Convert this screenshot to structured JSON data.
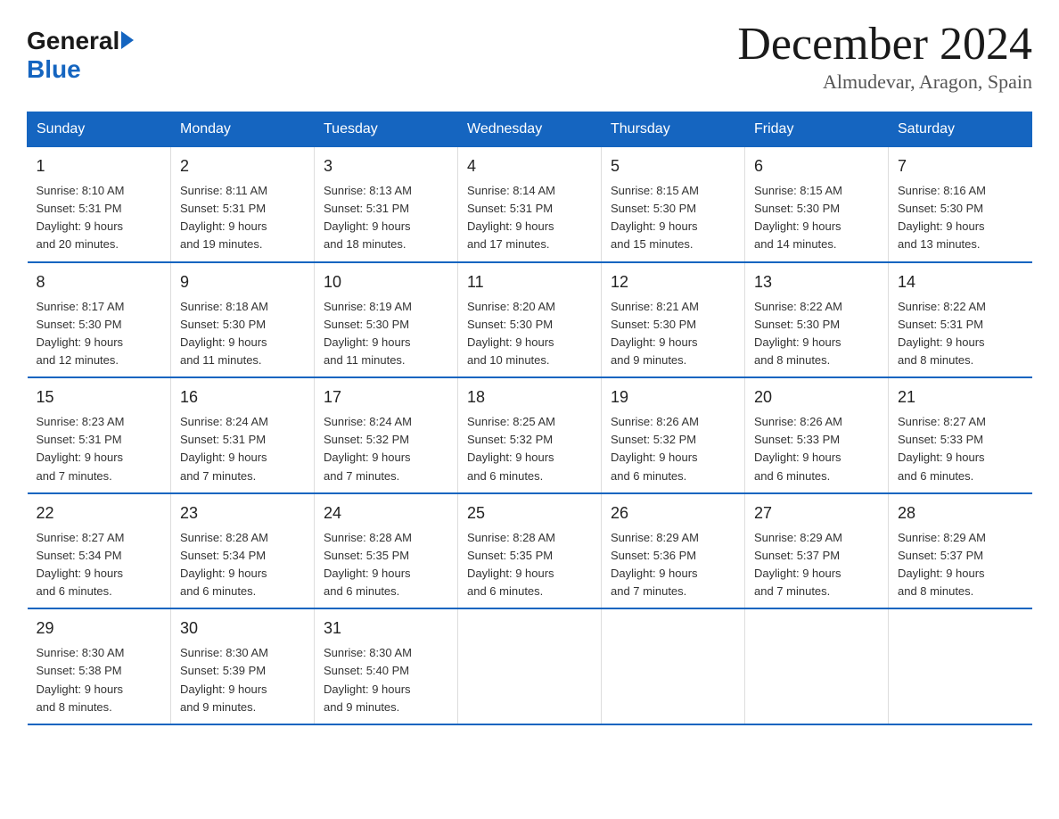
{
  "logo": {
    "general": "General",
    "blue": "Blue"
  },
  "title": {
    "month_year": "December 2024",
    "location": "Almudevar, Aragon, Spain"
  },
  "days_of_week": [
    "Sunday",
    "Monday",
    "Tuesday",
    "Wednesday",
    "Thursday",
    "Friday",
    "Saturday"
  ],
  "weeks": [
    [
      {
        "day": "1",
        "sunrise": "8:10 AM",
        "sunset": "5:31 PM",
        "daylight": "9 hours and 20 minutes."
      },
      {
        "day": "2",
        "sunrise": "8:11 AM",
        "sunset": "5:31 PM",
        "daylight": "9 hours and 19 minutes."
      },
      {
        "day": "3",
        "sunrise": "8:13 AM",
        "sunset": "5:31 PM",
        "daylight": "9 hours and 18 minutes."
      },
      {
        "day": "4",
        "sunrise": "8:14 AM",
        "sunset": "5:31 PM",
        "daylight": "9 hours and 17 minutes."
      },
      {
        "day": "5",
        "sunrise": "8:15 AM",
        "sunset": "5:30 PM",
        "daylight": "9 hours and 15 minutes."
      },
      {
        "day": "6",
        "sunrise": "8:15 AM",
        "sunset": "5:30 PM",
        "daylight": "9 hours and 14 minutes."
      },
      {
        "day": "7",
        "sunrise": "8:16 AM",
        "sunset": "5:30 PM",
        "daylight": "9 hours and 13 minutes."
      }
    ],
    [
      {
        "day": "8",
        "sunrise": "8:17 AM",
        "sunset": "5:30 PM",
        "daylight": "9 hours and 12 minutes."
      },
      {
        "day": "9",
        "sunrise": "8:18 AM",
        "sunset": "5:30 PM",
        "daylight": "9 hours and 11 minutes."
      },
      {
        "day": "10",
        "sunrise": "8:19 AM",
        "sunset": "5:30 PM",
        "daylight": "9 hours and 11 minutes."
      },
      {
        "day": "11",
        "sunrise": "8:20 AM",
        "sunset": "5:30 PM",
        "daylight": "9 hours and 10 minutes."
      },
      {
        "day": "12",
        "sunrise": "8:21 AM",
        "sunset": "5:30 PM",
        "daylight": "9 hours and 9 minutes."
      },
      {
        "day": "13",
        "sunrise": "8:22 AM",
        "sunset": "5:30 PM",
        "daylight": "9 hours and 8 minutes."
      },
      {
        "day": "14",
        "sunrise": "8:22 AM",
        "sunset": "5:31 PM",
        "daylight": "9 hours and 8 minutes."
      }
    ],
    [
      {
        "day": "15",
        "sunrise": "8:23 AM",
        "sunset": "5:31 PM",
        "daylight": "9 hours and 7 minutes."
      },
      {
        "day": "16",
        "sunrise": "8:24 AM",
        "sunset": "5:31 PM",
        "daylight": "9 hours and 7 minutes."
      },
      {
        "day": "17",
        "sunrise": "8:24 AM",
        "sunset": "5:32 PM",
        "daylight": "9 hours and 7 minutes."
      },
      {
        "day": "18",
        "sunrise": "8:25 AM",
        "sunset": "5:32 PM",
        "daylight": "9 hours and 6 minutes."
      },
      {
        "day": "19",
        "sunrise": "8:26 AM",
        "sunset": "5:32 PM",
        "daylight": "9 hours and 6 minutes."
      },
      {
        "day": "20",
        "sunrise": "8:26 AM",
        "sunset": "5:33 PM",
        "daylight": "9 hours and 6 minutes."
      },
      {
        "day": "21",
        "sunrise": "8:27 AM",
        "sunset": "5:33 PM",
        "daylight": "9 hours and 6 minutes."
      }
    ],
    [
      {
        "day": "22",
        "sunrise": "8:27 AM",
        "sunset": "5:34 PM",
        "daylight": "9 hours and 6 minutes."
      },
      {
        "day": "23",
        "sunrise": "8:28 AM",
        "sunset": "5:34 PM",
        "daylight": "9 hours and 6 minutes."
      },
      {
        "day": "24",
        "sunrise": "8:28 AM",
        "sunset": "5:35 PM",
        "daylight": "9 hours and 6 minutes."
      },
      {
        "day": "25",
        "sunrise": "8:28 AM",
        "sunset": "5:35 PM",
        "daylight": "9 hours and 6 minutes."
      },
      {
        "day": "26",
        "sunrise": "8:29 AM",
        "sunset": "5:36 PM",
        "daylight": "9 hours and 7 minutes."
      },
      {
        "day": "27",
        "sunrise": "8:29 AM",
        "sunset": "5:37 PM",
        "daylight": "9 hours and 7 minutes."
      },
      {
        "day": "28",
        "sunrise": "8:29 AM",
        "sunset": "5:37 PM",
        "daylight": "9 hours and 8 minutes."
      }
    ],
    [
      {
        "day": "29",
        "sunrise": "8:30 AM",
        "sunset": "5:38 PM",
        "daylight": "9 hours and 8 minutes."
      },
      {
        "day": "30",
        "sunrise": "8:30 AM",
        "sunset": "5:39 PM",
        "daylight": "9 hours and 9 minutes."
      },
      {
        "day": "31",
        "sunrise": "8:30 AM",
        "sunset": "5:40 PM",
        "daylight": "9 hours and 9 minutes."
      },
      null,
      null,
      null,
      null
    ]
  ],
  "labels": {
    "sunrise": "Sunrise:",
    "sunset": "Sunset:",
    "daylight": "Daylight:"
  }
}
